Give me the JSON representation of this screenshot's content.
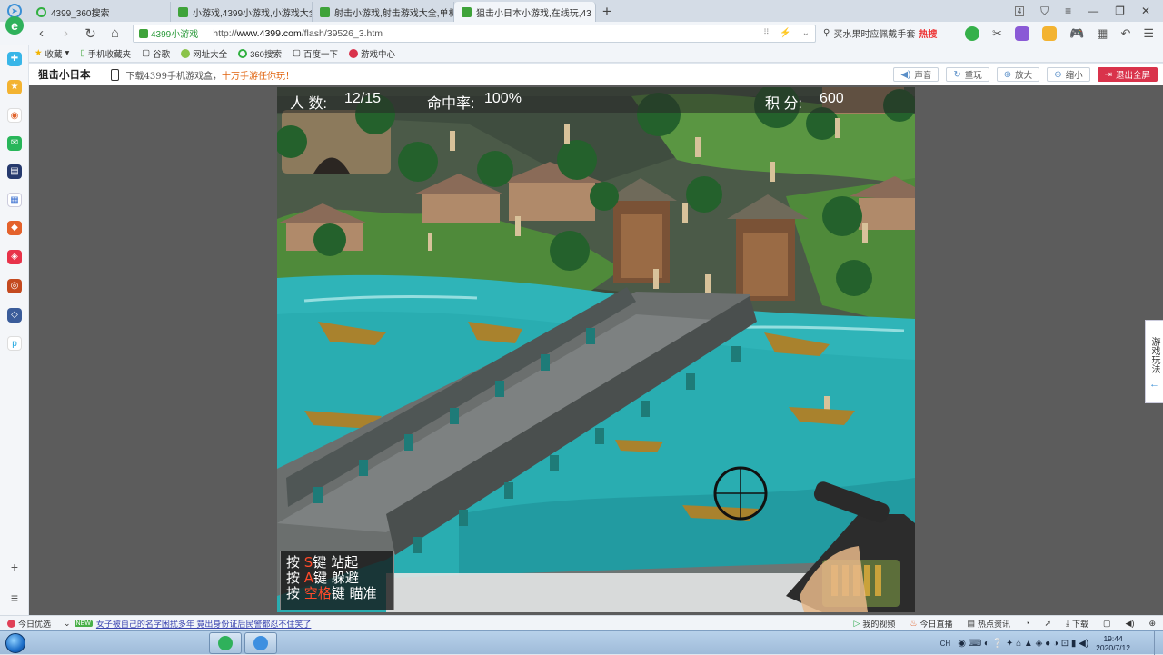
{
  "tabs": [
    {
      "label": "4399_360搜索",
      "icon": "360-search-icon"
    },
    {
      "label": "小游戏,4399小游戏,小游戏大全",
      "icon": "4399-icon"
    },
    {
      "label": "射击小游戏,射击游戏大全,单机",
      "icon": "4399-icon"
    },
    {
      "label": "狙击小日本小游戏,在线玩,43",
      "icon": "4399-icon"
    }
  ],
  "window": {
    "tab_count": "4"
  },
  "address": {
    "site_label": "4399小游戏",
    "url_prefix": "http://",
    "url_domain": "www.4399.com",
    "url_path": "/flash/39526_3.htm"
  },
  "search": {
    "text": "买水果时应佩戴手套",
    "hot_badge": "热搜"
  },
  "bookmarks": [
    "收藏",
    "手机收藏夹",
    "谷歌",
    "网址大全",
    "360搜索",
    "百度一下",
    "游戏中心"
  ],
  "game_header": {
    "title": "狙击小日本",
    "promo_prefix": "下载4399手机游戏盒，",
    "promo_highlight": "十万手游任你玩！",
    "buttons": [
      "声音",
      "重玩",
      "放大",
      "缩小",
      "退出全屏"
    ]
  },
  "hud": {
    "people_label": "人  数:",
    "people_value": "12/15",
    "accuracy_label": "命中率:",
    "accuracy_value": "100%",
    "score_label": "积   分:",
    "score_value": "600"
  },
  "help": {
    "line1_prefix": "按 ",
    "line1_key": "S",
    "line1_suffix": "键 站起",
    "line2_prefix": "按 ",
    "line2_key": "A",
    "line2_suffix": "键 躲避",
    "line3_prefix": "按 ",
    "line3_key": "空格",
    "line3_suffix": "键 瞄准"
  },
  "side_panel": {
    "label": "游戏玩法"
  },
  "status_bar": {
    "today": "今日优选",
    "news_tag": "NEW",
    "news": "女子被自己的名字困扰多年 竟出身份证后民警都忍不住笑了",
    "items": [
      "我的视频",
      "今日直播",
      "热点资讯",
      "下载"
    ]
  },
  "taskbar": {
    "lang": "CH",
    "time": "19:44",
    "date": "2020/7/12"
  },
  "colors": {
    "accent_red": "#d9334b",
    "help_key": "#ff4a2a",
    "water": "#2fb4b8",
    "grass": "#4f8a3a"
  }
}
